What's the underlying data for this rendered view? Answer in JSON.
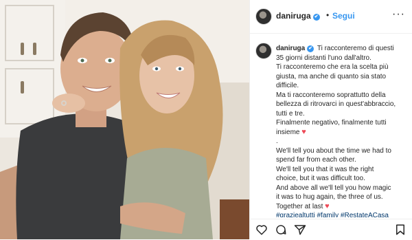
{
  "post": {
    "username": "daniruga",
    "verified_glyph": "✔",
    "follow_label": "Segui",
    "separator": "•",
    "more_glyph": "···",
    "caption_lines": [
      "Ti racconteremo di questi",
      "35 giorni distanti l'uno dall'altro.",
      "Ti racconteremo che era la scelta più",
      "giusta, ma anche di quanto sia stato",
      "difficile.",
      "Ma ti racconteremo soprattutto della",
      "bellezza di ritrovarci in quest'abbraccio,",
      "tutti e tre.",
      "Finalmente negativo, finalmente tutti",
      "insieme",
      ".",
      "We'll tell you about the time we had to",
      "spend far from each other.",
      "We'll tell you that it was the right",
      "choice, but it was difficult too.",
      "And above all we'll tell you how magic",
      "it was to hug again, the three of us.",
      "Together at last"
    ],
    "heart_glyph": "♥",
    "hashtags": "#graziealtutti #family #RestateACasa",
    "icons": [
      "heart-icon",
      "comment-icon",
      "share-icon",
      "bookmark-icon"
    ],
    "colors": {
      "link": "#3897f0",
      "heart": "#ed4956",
      "hashtag": "#00376b",
      "text": "#262626"
    }
  }
}
